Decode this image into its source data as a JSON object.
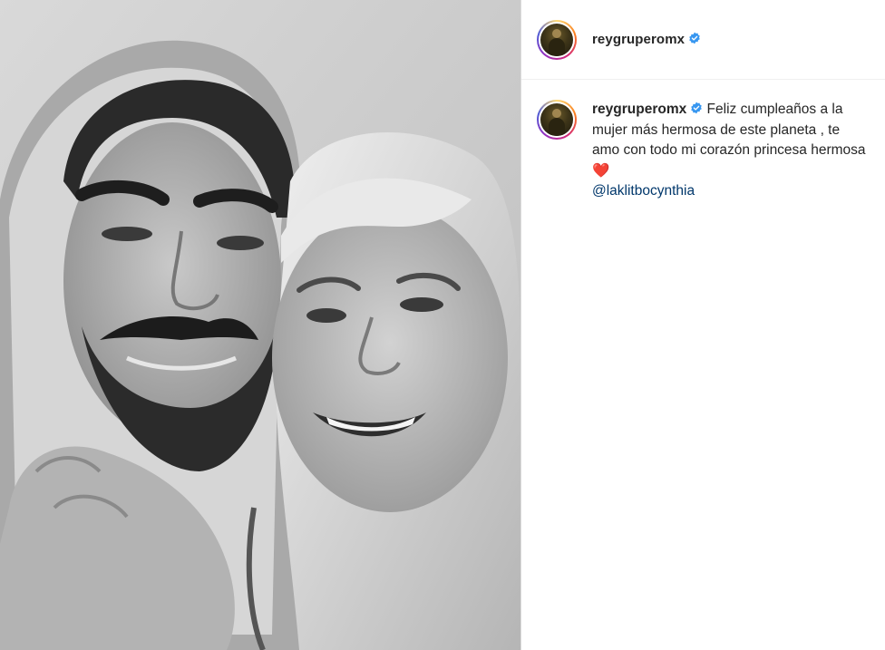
{
  "post": {
    "username": "reygruperomx",
    "caption": {
      "username": "reygruperomx",
      "text": "Feliz cumpleaños a la mujer más hermosa de este planeta , te amo con todo mi corazón princesa hermosa",
      "emoji": "❤️",
      "mention": "@laklitbocynthia"
    }
  },
  "icons": {
    "verified": "verified-badge-icon",
    "heart": "red-heart-emoji"
  },
  "colors": {
    "verified_blue": "#3897f0",
    "mention": "#00376b",
    "text": "#262626"
  }
}
